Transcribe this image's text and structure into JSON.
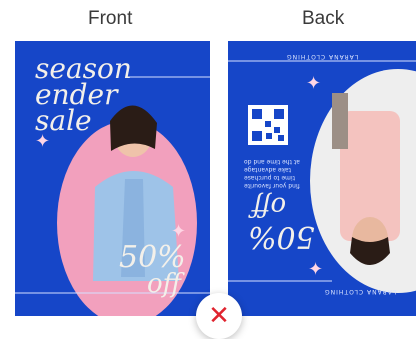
{
  "labels": {
    "front": "Front",
    "back": "Back"
  },
  "front": {
    "line1": "season",
    "line2": "ender",
    "line3": "sale",
    "pct": "50%",
    "off": "off"
  },
  "back": {
    "brand_top": "LARANA CLOTHING",
    "brand_bottom": "LARANA CLOTHING",
    "pct": "50%",
    "off": "off",
    "fine_lines": [
      "at the time and do",
      "take advantage",
      "time to purchase",
      "find your favourite"
    ]
  },
  "remove_icon": "close-icon",
  "colors": {
    "card": "#1646c8",
    "pink": "#f2a0bd",
    "close": "#e0242f"
  }
}
